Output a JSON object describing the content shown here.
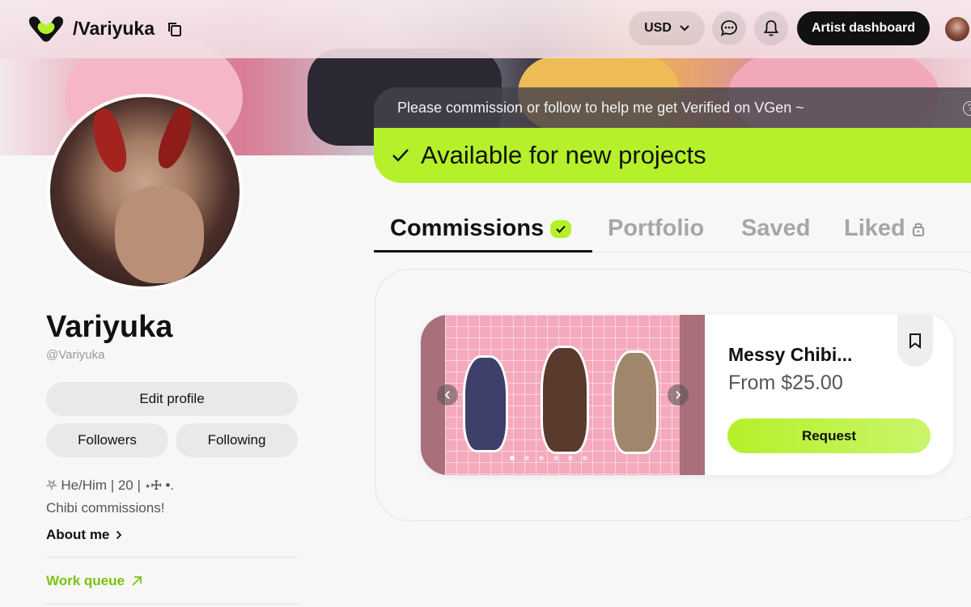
{
  "header": {
    "handle": "/Variyuka",
    "currency": "USD",
    "dashboard_label": "Artist dashboard"
  },
  "profile": {
    "name": "Variyuka",
    "handle": "@Variyuka",
    "edit_label": "Edit profile",
    "followers_label": "Followers",
    "following_label": "Following",
    "bio_line1": "⛧ He/Him | 20 | ⋆☩ •.",
    "bio_line2": "Chibi commissions!",
    "about_label": "About me",
    "work_queue_label": "Work queue"
  },
  "notice": {
    "text": "Please commission or follow to help me get Verified on VGen ~",
    "available_text": "Available for new projects"
  },
  "tabs": [
    {
      "label": "Commissions"
    },
    {
      "label": "Portfolio"
    },
    {
      "label": "Saved"
    },
    {
      "label": "Liked"
    }
  ],
  "commission": {
    "title": "Messy Chibi...",
    "price": "From $25.00",
    "request_label": "Request",
    "slides_total": 6,
    "slide_active": 1
  },
  "colors": {
    "accent": "#b5f02a",
    "work_queue": "#7cc20e",
    "dark": "#111111"
  }
}
